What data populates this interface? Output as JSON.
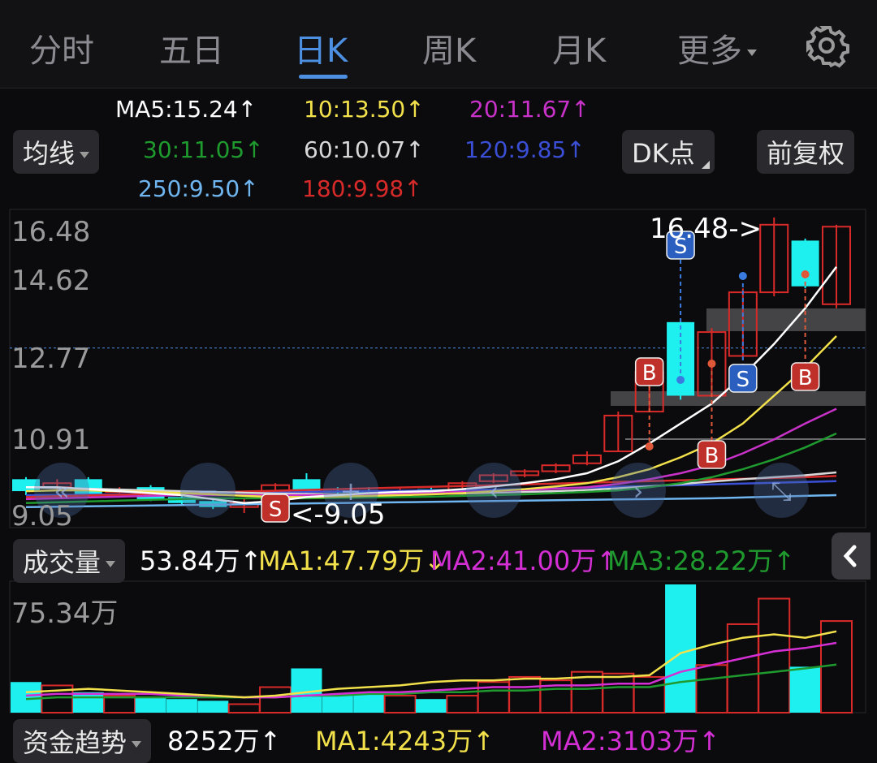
{
  "tabs": [
    {
      "label": "分时",
      "active": false
    },
    {
      "label": "五日",
      "active": false
    },
    {
      "label": "日K",
      "active": true
    },
    {
      "label": "周K",
      "active": false
    },
    {
      "label": "月K",
      "active": false
    },
    {
      "label": "更多",
      "active": false
    }
  ],
  "settings_icon": "gear-icon",
  "ma_selector": "均线",
  "dk_button": "DK点",
  "adjust_button": "前复权",
  "ma_values": [
    {
      "text": "MA5:15.24↑",
      "color": "#ffffff"
    },
    {
      "text": "10:13.50↑",
      "color": "#f2e14b"
    },
    {
      "text": "20:11.67↑",
      "color": "#c832c8"
    },
    {
      "text": "30:11.05↑",
      "color": "#1f9a2e"
    },
    {
      "text": "60:10.07↑",
      "color": "#d8d8d8"
    },
    {
      "text": "120:9.85↑",
      "color": "#3a4fd6"
    },
    {
      "text": "250:9.50↑",
      "color": "#6fb6f0"
    },
    {
      "text": "180:9.98↑",
      "color": "#d92a2a"
    }
  ],
  "price_axis": [
    "16.48",
    "14.62",
    "12.77",
    "10.91",
    "9.05"
  ],
  "high_marker": "16.48->",
  "low_marker": "<-9.05",
  "signal_labels": {
    "buy": "B",
    "sell": "S"
  },
  "volume_selector": "成交量",
  "volume_values": [
    {
      "text": "53.84万↑",
      "color": "#ffffff"
    },
    {
      "text": "MA1:47.79万↓",
      "color": "#f2e14b"
    },
    {
      "text": "MA2:41.00万↑",
      "color": "#d42fd4"
    },
    {
      "text": "MA3:28.22万↑",
      "color": "#1f9a2e"
    }
  ],
  "volume_axis": "75.34万",
  "fund_selector": "资金趋势",
  "fund_values": [
    {
      "text": "8252万↑",
      "color": "#ffffff"
    },
    {
      "text": "MA1:4243万↑",
      "color": "#f2e14b"
    },
    {
      "text": "MA2:3103万↑",
      "color": "#d42fd4"
    }
  ],
  "colors": {
    "up": "#d92a2a",
    "down": "#1ef0f0",
    "accent": "#4d8fe0"
  },
  "chart_data": {
    "type": "candlestick",
    "price_range": [
      9.05,
      16.48
    ],
    "candles": [
      {
        "o": 9.9,
        "c": 9.6,
        "h": 9.95,
        "l": 9.5
      },
      {
        "o": 9.7,
        "c": 9.8,
        "h": 9.9,
        "l": 9.6
      },
      {
        "o": 9.9,
        "c": 9.5,
        "h": 9.95,
        "l": 9.45
      },
      {
        "o": 9.6,
        "c": 9.62,
        "h": 9.7,
        "l": 9.55
      },
      {
        "o": 9.7,
        "c": 9.4,
        "h": 9.75,
        "l": 9.35
      },
      {
        "o": 9.45,
        "c": 9.3,
        "h": 9.55,
        "l": 9.25
      },
      {
        "o": 9.35,
        "c": 9.2,
        "h": 9.4,
        "l": 9.15
      },
      {
        "o": 9.2,
        "c": 9.3,
        "h": 9.4,
        "l": 9.05
      },
      {
        "o": 9.3,
        "c": 9.75,
        "h": 9.8,
        "l": 9.25
      },
      {
        "o": 9.9,
        "c": 9.6,
        "h": 10.05,
        "l": 9.55
      },
      {
        "o": 9.6,
        "c": 9.58,
        "h": 9.7,
        "l": 9.5
      },
      {
        "o": 9.6,
        "c": 9.58,
        "h": 9.7,
        "l": 9.5
      },
      {
        "o": 9.6,
        "c": 9.6,
        "h": 9.7,
        "l": 9.5
      },
      {
        "o": 9.65,
        "c": 9.6,
        "h": 9.7,
        "l": 9.55
      },
      {
        "o": 9.6,
        "c": 9.8,
        "h": 9.85,
        "l": 9.55
      },
      {
        "o": 9.85,
        "c": 10.0,
        "h": 10.05,
        "l": 9.8
      },
      {
        "o": 10.0,
        "c": 10.1,
        "h": 10.15,
        "l": 9.95
      },
      {
        "o": 10.1,
        "c": 10.25,
        "h": 10.3,
        "l": 10.05
      },
      {
        "o": 10.3,
        "c": 10.5,
        "h": 10.6,
        "l": 10.25
      },
      {
        "o": 10.6,
        "c": 11.5,
        "h": 11.6,
        "l": 10.6
      },
      {
        "o": 11.6,
        "c": 12.6,
        "h": 12.7,
        "l": 11.6
      },
      {
        "o": 13.85,
        "c": 12.0,
        "h": 13.9,
        "l": 11.9
      },
      {
        "o": 12.0,
        "c": 13.6,
        "h": 13.7,
        "l": 12.0
      },
      {
        "o": 13.0,
        "c": 14.6,
        "h": 14.7,
        "l": 12.9
      },
      {
        "o": 14.6,
        "c": 16.3,
        "h": 16.48,
        "l": 14.5
      },
      {
        "o": 15.9,
        "c": 14.75,
        "h": 15.95,
        "l": 14.7
      },
      {
        "o": 14.3,
        "c": 16.25,
        "h": 16.3,
        "l": 14.2
      }
    ],
    "ma5": [
      9.7,
      9.7,
      9.65,
      9.6,
      9.55,
      9.5,
      9.4,
      9.3,
      9.35,
      9.45,
      9.5,
      9.55,
      9.58,
      9.6,
      9.65,
      9.72,
      9.8,
      9.9,
      10.05,
      10.35,
      10.8,
      11.3,
      11.8,
      12.5,
      13.3,
      14.2,
      15.24
    ],
    "ma10": [
      9.6,
      9.62,
      9.62,
      9.6,
      9.58,
      9.55,
      9.52,
      9.48,
      9.45,
      9.45,
      9.46,
      9.48,
      9.5,
      9.52,
      9.55,
      9.6,
      9.65,
      9.72,
      9.8,
      9.95,
      10.15,
      10.45,
      10.8,
      11.3,
      12.0,
      12.7,
      13.5
    ],
    "ma20": [
      9.4,
      9.42,
      9.44,
      9.46,
      9.48,
      9.5,
      9.5,
      9.5,
      9.5,
      9.5,
      9.5,
      9.52,
      9.54,
      9.56,
      9.58,
      9.6,
      9.63,
      9.66,
      9.7,
      9.78,
      9.9,
      10.05,
      10.25,
      10.55,
      10.9,
      11.3,
      11.67
    ],
    "ma30": [
      9.3,
      9.32,
      9.34,
      9.36,
      9.38,
      9.4,
      9.42,
      9.42,
      9.42,
      9.42,
      9.43,
      9.44,
      9.45,
      9.46,
      9.48,
      9.5,
      9.52,
      9.55,
      9.58,
      9.62,
      9.7,
      9.8,
      9.95,
      10.15,
      10.4,
      10.7,
      11.05
    ],
    "ma60": [
      9.7,
      9.68,
      9.66,
      9.64,
      9.62,
      9.6,
      9.58,
      9.56,
      9.54,
      9.53,
      9.52,
      9.52,
      9.52,
      9.53,
      9.54,
      9.56,
      9.58,
      9.6,
      9.63,
      9.67,
      9.72,
      9.78,
      9.84,
      9.9,
      9.95,
      10.0,
      10.07
    ],
    "ma120": [
      9.5,
      9.5,
      9.51,
      9.52,
      9.53,
      9.54,
      9.55,
      9.56,
      9.57,
      9.58,
      9.59,
      9.6,
      9.61,
      9.62,
      9.63,
      9.64,
      9.65,
      9.67,
      9.69,
      9.71,
      9.73,
      9.75,
      9.77,
      9.79,
      9.81,
      9.83,
      9.85
    ],
    "ma250": [
      9.2,
      9.21,
      9.22,
      9.23,
      9.24,
      9.25,
      9.26,
      9.27,
      9.28,
      9.29,
      9.3,
      9.31,
      9.32,
      9.33,
      9.34,
      9.35,
      9.36,
      9.37,
      9.38,
      9.39,
      9.4,
      9.41,
      9.42,
      9.44,
      9.46,
      9.48,
      9.5
    ],
    "ma180": [
      9.45,
      9.47,
      9.49,
      9.51,
      9.53,
      9.55,
      9.57,
      9.59,
      9.61,
      9.63,
      9.65,
      9.67,
      9.69,
      9.71,
      9.73,
      9.75,
      9.77,
      9.79,
      9.81,
      9.83,
      9.85,
      9.87,
      9.89,
      9.91,
      9.93,
      9.95,
      9.98
    ],
    "volume": {
      "max": 75.34,
      "bars": [
        18,
        16,
        12,
        10,
        9,
        8,
        7,
        5,
        15,
        26,
        11,
        11,
        10,
        8,
        10,
        18,
        21,
        19,
        24,
        23,
        21,
        75.34,
        28,
        52,
        67,
        27,
        53.84
      ],
      "ma1": [
        12,
        13,
        14,
        13,
        12,
        11,
        10,
        9,
        10,
        12,
        14,
        15,
        16,
        18,
        19,
        19,
        20,
        20,
        21,
        21,
        22,
        35,
        40,
        44,
        46,
        44,
        47.79
      ],
      "ma2": [
        10,
        11,
        11,
        11,
        11,
        10,
        10,
        9,
        9,
        10,
        11,
        12,
        12,
        13,
        14,
        15,
        15,
        16,
        16,
        17,
        17,
        24,
        28,
        32,
        36,
        38,
        41.0
      ],
      "ma3": [
        8,
        9,
        9,
        9,
        9,
        9,
        9,
        9,
        9,
        10,
        10,
        11,
        11,
        12,
        12,
        13,
        13,
        14,
        14,
        15,
        15,
        18,
        20,
        22,
        24,
        26,
        28.22
      ]
    }
  }
}
